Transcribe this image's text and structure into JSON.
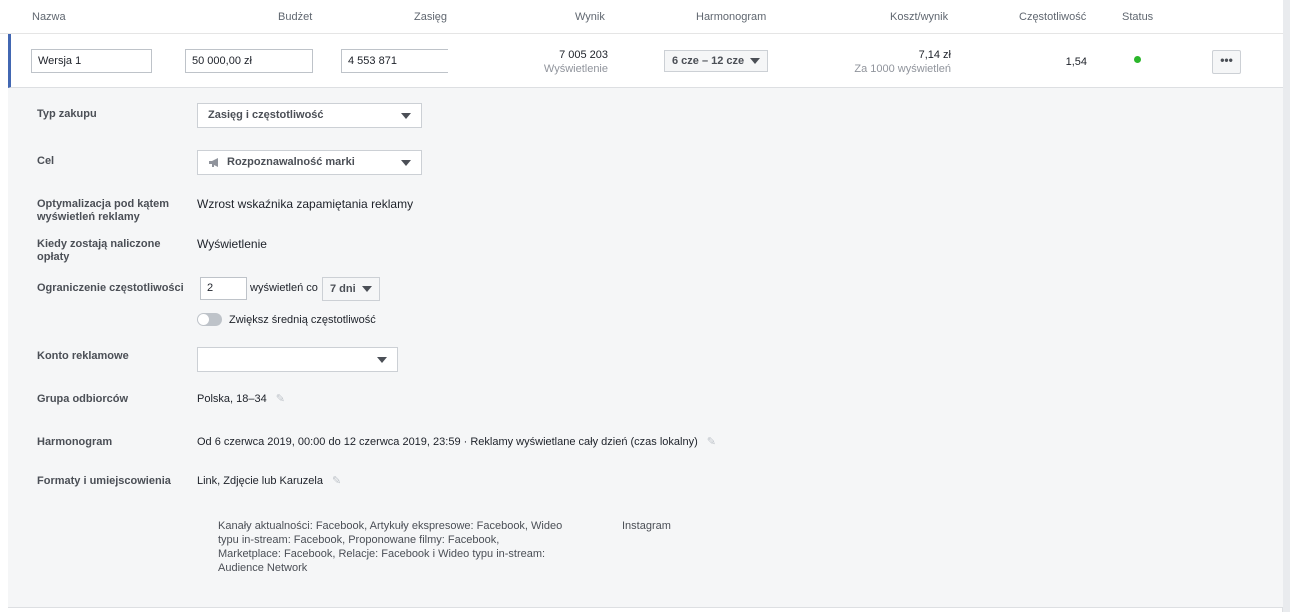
{
  "header": {
    "nazwa": "Nazwa",
    "budzet": "Budżet",
    "zasieg": "Zasięg",
    "wynik": "Wynik",
    "harmonogram": "Harmonogram",
    "koszt": "Koszt/wynik",
    "czestotliwosc": "Częstotliwość",
    "status": "Status"
  },
  "row": {
    "name": "Wersja 1",
    "budget": "50 000,00 zł",
    "reach": "4 553 871",
    "result": "7 005 203",
    "result_label": "Wyświetlenie",
    "schedule": "6 cze – 12 cze",
    "cost": "7,14 zł",
    "cost_label": "Za 1000 wyświetleń",
    "frequency": "1,54",
    "status_color": "#2bb62b",
    "more_label": "•••"
  },
  "details": {
    "purchase_type_label": "Typ zakupu",
    "purchase_type_value": "Zasięg i częstotliwość",
    "goal_label": "Cel",
    "goal_value": "Rozpoznawalność marki",
    "goal_icon": "megaphone-icon",
    "optimization_label": "Optymalizacja pod kątem wyświetleń reklamy",
    "optimization_value": "Wzrost wskaźnika zapamiętania reklamy",
    "billing_label": "Kiedy zostają naliczone opłaty",
    "billing_value": "Wyświetlenie",
    "freq_cap_label": "Ograniczenie częstotliwości",
    "freq_cap_value": "2",
    "freq_cap_mid": "wyświetleń co",
    "freq_cap_period": "7 dni",
    "toggle_label": "Zwiększ średnią częstotliwość",
    "account_label": "Konto reklamowe",
    "account_value": "",
    "audience_label": "Grupa odbiorców",
    "audience_value": "Polska, 18–34",
    "schedule_label": "Harmonogram",
    "schedule_value": "Od 6 czerwca 2019, 00:00 do 12 czerwca 2019, 23:59 · Reklamy wyświetlane cały dzień (czas lokalny)",
    "formats_label": "Formaty i umiejscowienia",
    "formats_value": "Link, Zdjęcie lub Karuzela",
    "placements_facebook": [
      "Kanały aktualności: Facebook, Artykuły ekspresowe: Facebook, Wideo",
      "typu in-stream: Facebook, Proponowane filmy: Facebook,",
      "Marketplace: Facebook, Relacje: Facebook i Wideo typu in-stream:",
      "Audience Network"
    ],
    "placements_instagram": "Instagram"
  }
}
